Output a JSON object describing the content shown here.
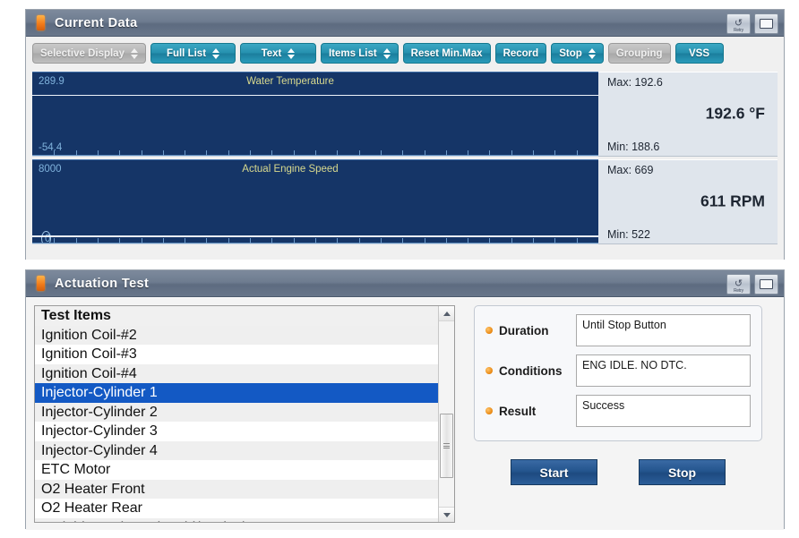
{
  "current_data_window": {
    "title": "Current Data",
    "titlebar_buttons": [
      {
        "name": "retry",
        "label": "Retry",
        "glyph": "↺"
      },
      {
        "name": "maximize",
        "label": "Maximize"
      }
    ],
    "toolbar": [
      {
        "label": "Selective Display",
        "style": "gray",
        "spinner": true
      },
      {
        "label": "Full List",
        "style": "teal",
        "spinner": true
      },
      {
        "label": "Text",
        "style": "teal",
        "spinner": true
      },
      {
        "label": "Items List",
        "style": "teal",
        "spinner": true
      },
      {
        "label": "Reset Min.Max",
        "style": "teal",
        "spinner": false
      },
      {
        "label": "Record",
        "style": "teal",
        "spinner": false
      },
      {
        "label": "Stop",
        "style": "teal",
        "spinner": true
      },
      {
        "label": "Grouping",
        "style": "gray",
        "spinner": false
      },
      {
        "label": "VSS",
        "style": "teal",
        "spinner": false
      }
    ],
    "graphs": [
      {
        "title": "Water Temperature",
        "scale_top": "289.9",
        "scale_bottom": "-54.4",
        "max_label": "Max: 192.6",
        "min_label": "Min: 188.6",
        "value": "192.6 °F"
      },
      {
        "title": "Actual Engine Speed",
        "scale_top": "8000",
        "scale_bottom": "0",
        "max_label": "Max: 669",
        "min_label": "Min: 522",
        "value": "611 RPM"
      }
    ]
  },
  "actuation_test_window": {
    "title": "Actuation Test",
    "titlebar_buttons": [
      {
        "name": "retry",
        "label": "Retry",
        "glyph": "↺"
      },
      {
        "name": "maximize",
        "label": "Maximize"
      }
    ],
    "list_header": "Test Items",
    "list_items": [
      {
        "label": "Ignition Coil-#2",
        "selected": false
      },
      {
        "label": "Ignition Coil-#3",
        "selected": false
      },
      {
        "label": "Ignition Coil-#4",
        "selected": false
      },
      {
        "label": "Injector-Cylinder 1",
        "selected": true
      },
      {
        "label": "Injector-Cylinder 2",
        "selected": false
      },
      {
        "label": "Injector-Cylinder 3",
        "selected": false
      },
      {
        "label": "Injector-Cylinder 4",
        "selected": false
      },
      {
        "label": "ETC Motor",
        "selected": false
      },
      {
        "label": "O2 Heater Front",
        "selected": false
      },
      {
        "label": "O2 Heater Rear",
        "selected": false
      },
      {
        "label": "Variable Intake Solenoid(Option)",
        "selected": false
      }
    ],
    "details": [
      {
        "label": "Duration",
        "value": "Until Stop Button"
      },
      {
        "label": "Conditions",
        "value": "ENG IDLE. NO DTC."
      },
      {
        "label": "Result",
        "value": "Success"
      }
    ],
    "buttons": [
      {
        "label": "Start"
      },
      {
        "label": "Stop"
      }
    ]
  },
  "colors": {
    "plot_background": "#153567",
    "trace": "#eef4fb",
    "accent_teal": "#2690ae",
    "selection_blue": "#1359c4",
    "action_blue": "#24558e",
    "title_led": "#f07818"
  },
  "chart_data": [
    {
      "type": "line",
      "title": "Water Temperature",
      "ylabel": "°F",
      "ylim": [
        -54.4,
        289.9
      ],
      "value_current": 192.6,
      "value_max": 192.6,
      "value_min": 188.6,
      "series": [
        {
          "name": "Water Temperature",
          "values": [
            192.6,
            192.6,
            192.6,
            192.6,
            192.6,
            192.6,
            192.6,
            192.6,
            192.6,
            192.6,
            192.6,
            192.6
          ]
        }
      ],
      "grid": false,
      "legend": "none"
    },
    {
      "type": "line",
      "title": "Actual Engine Speed",
      "ylabel": "RPM",
      "ylim": [
        0,
        8000
      ],
      "value_current": 611,
      "value_max": 669,
      "value_min": 522,
      "series": [
        {
          "name": "Actual Engine Speed",
          "values": [
            600,
            612,
            605,
            618,
            608,
            611,
            622,
            609,
            615,
            604,
            611,
            611
          ]
        }
      ],
      "grid": false,
      "legend": "none"
    }
  ]
}
